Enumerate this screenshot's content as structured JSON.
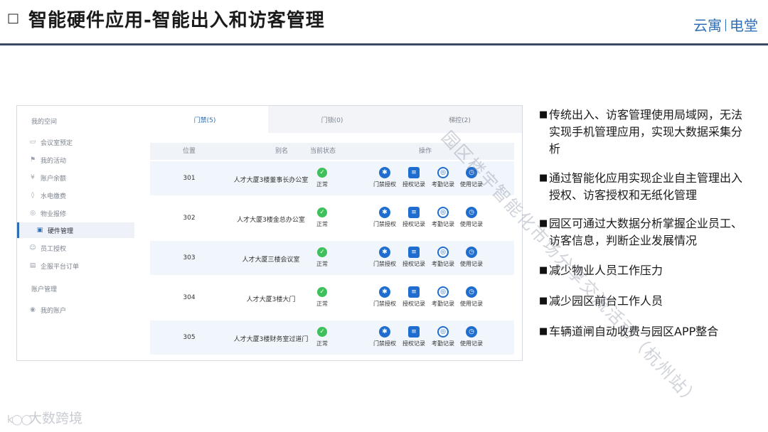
{
  "header": {
    "marker": "□",
    "title": "智能硬件应用-智能出入和访客管理",
    "brand_left": "云寓",
    "brand_right": "电堂"
  },
  "sidebar": {
    "section_title": "我的空间",
    "items": [
      {
        "label": "会议室预定",
        "icon": "meeting-room-icon"
      },
      {
        "label": "我的活动",
        "icon": "activity-icon"
      },
      {
        "label": "账户余额",
        "icon": "balance-icon"
      },
      {
        "label": "水电缴费",
        "icon": "utility-icon"
      },
      {
        "label": "物业报修",
        "icon": "repair-icon"
      },
      {
        "label": "硬件管理",
        "icon": "hardware-icon",
        "active": true
      },
      {
        "label": "员工授权",
        "icon": "person-icon"
      },
      {
        "label": "企服平台订单",
        "icon": "order-icon"
      }
    ],
    "account_title": "账户管理",
    "account_items": [
      {
        "label": "我的账户",
        "icon": "account-icon"
      }
    ]
  },
  "tabs": [
    {
      "label": "门禁(5)",
      "active": true
    },
    {
      "label": "门锁(0)"
    },
    {
      "label": "梯控(2)"
    }
  ],
  "table": {
    "headers": [
      "位置",
      "别名",
      "当前状态",
      "操作"
    ],
    "rows": [
      {
        "position": "301",
        "alias": "人才大厦3楼董事长办公室",
        "status": "正常"
      },
      {
        "position": "302",
        "alias": "人才大厦3楼金总办公室",
        "status": "正常"
      },
      {
        "position": "303",
        "alias": "人才大厦三楼会议室",
        "status": "正常"
      },
      {
        "position": "304",
        "alias": "人才大厦3楼大门",
        "status": "正常"
      },
      {
        "position": "305",
        "alias": "人才大厦3楼财务室过道门",
        "status": "正常"
      }
    ],
    "actions": [
      {
        "label": "门禁授权",
        "icon": "gear-icon"
      },
      {
        "label": "授权记录",
        "icon": "document-icon"
      },
      {
        "label": "考勤记录",
        "icon": "fingerprint-icon"
      },
      {
        "label": "使用记录",
        "icon": "clock-icon"
      }
    ]
  },
  "bullets": [
    "传统出入、访客管理使用局域网，无法实现手机管理应用，实现大数据采集分析",
    "通过智能化应用实现企业自主管理出入授权、访客授权和无纸化管理",
    "园区可通过大数据分析掌握企业员工、访客信息，判断企业发展情况",
    "减少物业人员工作压力",
    "减少园区前台工作人员",
    "车辆道闸自动收费与园区APP整合"
  ],
  "watermark": "园区楼宇智能化市场分享交流活动（杭州站）",
  "footer": {
    "logo_text": "大数跨境"
  },
  "colors": {
    "accent": "#2f6fb5",
    "action_blue": "#1f6ecf",
    "status_ok": "#3ec15a",
    "header_line": "#3a4a64"
  }
}
